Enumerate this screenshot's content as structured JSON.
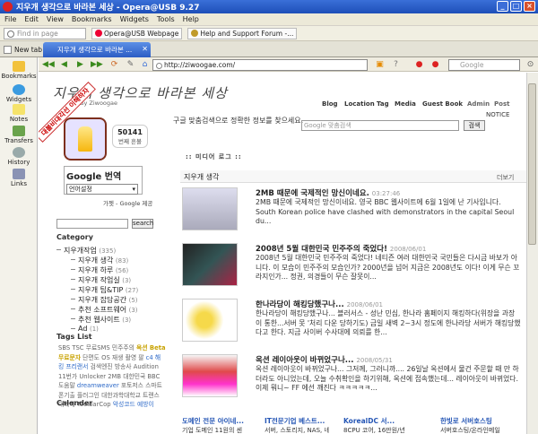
{
  "window": {
    "title": "지우개 생각으로 바라본 세상 - Opera@USB 9.27"
  },
  "menu": [
    "File",
    "Edit",
    "View",
    "Bookmarks",
    "Widgets",
    "Tools",
    "Help"
  ],
  "linkbar": {
    "find_placeholder": "Find in page",
    "bookmarks": [
      "Opera@USB Webpage",
      "Help and Support Forum -..."
    ]
  },
  "tabs": {
    "new_tab": "New tab",
    "active": "지우개 생각으로 바라본 ..."
  },
  "panel": [
    "Bookmarks",
    "Widgets",
    "Notes",
    "Transfers",
    "History",
    "Links"
  ],
  "address": {
    "url": "http://ziwoogae.com/",
    "search_placeholder": "Google"
  },
  "site": {
    "title": "지우개 생각으로 바라본 세상",
    "byline": "By Ziwoogae",
    "ribbon": "대불비대각선 이해하자",
    "nav": [
      "Blog",
      "Location",
      "Tag",
      "Media",
      "Guest Book",
      "Admin",
      "Post"
    ],
    "counter": {
      "value": "50141",
      "label": "번째 흔볼"
    },
    "translate": {
      "brand": "Google 번역",
      "select": "언어설정",
      "powered": "가젯 - Google 제공"
    },
    "side_search_btn": "search",
    "category_head": "Category",
    "categories": [
      {
        "label": "지우개작업",
        "count": "(335)"
      },
      {
        "label": "지우개 생각",
        "count": "(83)"
      },
      {
        "label": "지우개 하루",
        "count": "(56)"
      },
      {
        "label": "지우개 작업실",
        "count": "(3)"
      },
      {
        "label": "지우개 팁&TIP",
        "count": "(27)"
      },
      {
        "label": "지우개 잡담공간",
        "count": "(5)"
      },
      {
        "label": "추천 소프트웨어",
        "count": "(3)"
      },
      {
        "label": "추천 웹사이트",
        "count": "(3)"
      },
      {
        "label": "Ad",
        "count": "(1)"
      }
    ],
    "tags_head": "Tags List",
    "tags_text": "SBS TSC 무료SMS 민주주의 ",
    "tags_hl1": "옥션 Beta 무료문자",
    "tags_text2": " 단편도 OS 재생 촬영 팔 ",
    "tags_hl2": "c4 해킹 프리랜서",
    "tags_text3": " 검색엔진 방송사 Audition 11번가 Unlocker 2MB 대한민국 BBC 도움말 ",
    "tags_hl3": "dreamweaver",
    "tags_text4": " 포토저스 스마트폰기출 플러그인 대한과학대학교 트랜스 대학에 ToolbarCop ",
    "tags_hl4": "악성코드 예방이",
    "calendar_head": "Calender",
    "cse_label": "구글 맞춤검색으로 정확한 정보를 찾으세요.",
    "cse_placeholder": "Google 맞춤검색",
    "cse_btn": "검색",
    "notice": "NOTICE",
    "media_head": ":: 미디어 로그 ::",
    "section": "지우개 생각",
    "more": "더보기",
    "posts": [
      {
        "title": "2MB 때문에 국제적인 망신이네요.",
        "date": "03:27:46",
        "body": "2MB 때문에 국제적인 망신이네요. 영국 BBC 웹사이트에 6월 1일에 난 기사입니다. South Korean police have clashed with demonstrators in the capital Seoul du..."
      },
      {
        "title": "2008년 5월 대한민국 민주주의 죽었다!",
        "date": "2008/06/01",
        "body": "2008년 5월 대한민국 민주주의 죽었다! 네티즌 여러 대한민국 국민들은 다시금 바보가 아니다. 이 모습이 민주주의 모습인가? 2000년을 넘어 지금은 2008년도 이다! 이게 무슨 꼬라지인가... 정권, 의경들이 무슨 잘못이..."
      },
      {
        "title": "한나라당이 해킹당했구나...",
        "date": "2008/06/01",
        "body": "한나라당이 해킹당했구나... 블러서스 - 성난 민심, 한나라 홈페이지 해킹하다(위장을 과장이 통한...서버 못 '처리 다운 당하기도) 금일 새벽 2~3시 정도에 한나라당 서버가 해킹당했다고 한다. 지금 사이버 수사대에 의뢰를 한..."
      },
      {
        "title": "옥션 레이아웃이 바뀌었구나...",
        "date": "2008/05/31",
        "body": "옥션 레이아웃이 바뀌었구나... 그저께, 그러니까.... 26일날 옥션에서 물건 주문할 때 만 하더라도 아니었는데, 오늘 수취확인을 하기위해, 옥션에 접속했는데... 레이아웃이 바뀌었다. 이제 뭐니~ FF 에선 깨진다 ㅋㅋㅋㅋㅋ..."
      }
    ],
    "ads": [
      {
        "title": "도메인 전문 아이네...",
        "sub": "기업 도메인 11원의 센"
      },
      {
        "title": "IT전문기업 베스트...",
        "sub": "서버, 스토리지, NAS, 네"
      },
      {
        "title": "KorealDC 서...",
        "sub": "8CPU 코어, 16만원/년"
      },
      {
        "title": "한빛로 서버호스팅",
        "sub": "서버호스팅/온라인메일"
      }
    ]
  }
}
